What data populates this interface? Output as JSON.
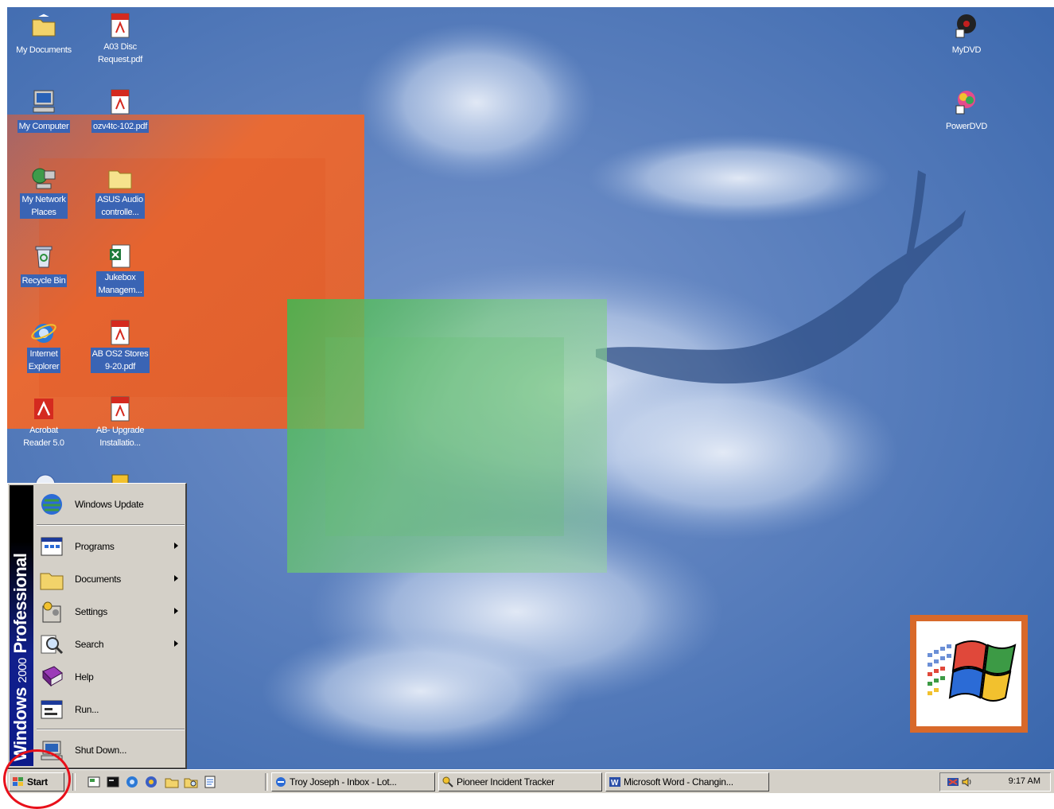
{
  "desktop": {
    "icons_left": [
      {
        "label": "My Documents",
        "icon": "folder-documents-icon",
        "selected": false
      },
      {
        "label": "A03 Disc\nRequest.pdf",
        "icon": "pdf-file-icon",
        "selected": false
      },
      {
        "label": "My Computer",
        "icon": "computer-icon",
        "selected": true
      },
      {
        "label": "ozv4tc-102.pdf",
        "icon": "pdf-file-icon",
        "selected": true
      },
      {
        "label": "My Network\nPlaces",
        "icon": "network-places-icon",
        "selected": true
      },
      {
        "label": "ASUS Audio\ncontrolle...",
        "icon": "folder-icon",
        "selected": true
      },
      {
        "label": "Recycle Bin",
        "icon": "recycle-bin-icon",
        "selected": true
      },
      {
        "label": "Jukebox\nManagem...",
        "icon": "excel-file-icon",
        "selected": true
      },
      {
        "label": "Internet\nExplorer",
        "icon": "internet-explorer-icon",
        "selected": true
      },
      {
        "label": "AB OS2 Stores\n9-20.pdf",
        "icon": "pdf-file-icon",
        "selected": true
      },
      {
        "label": "Acrobat\nReader 5.0",
        "icon": "acrobat-reader-icon",
        "selected": false
      },
      {
        "label": "AB- Upgrade\nInstallatio...",
        "icon": "pdf-file-icon",
        "selected": false
      }
    ],
    "icons_right": [
      {
        "label": "MyDVD",
        "icon": "mydvd-icon"
      },
      {
        "label": "PowerDVD",
        "icon": "powerdvd-icon"
      }
    ]
  },
  "start_menu": {
    "banner_bold": "Windows",
    "banner_light": "2000",
    "banner_edition": "Professional",
    "items": [
      {
        "label": "Windows Update",
        "icon": "windows-update-icon",
        "submenu": false
      },
      {
        "label": "Programs",
        "icon": "programs-icon",
        "submenu": true
      },
      {
        "label": "Documents",
        "icon": "documents-folder-icon",
        "submenu": true
      },
      {
        "label": "Settings",
        "icon": "settings-icon",
        "submenu": true
      },
      {
        "label": "Search",
        "icon": "search-icon",
        "submenu": true
      },
      {
        "label": "Help",
        "icon": "help-book-icon",
        "submenu": false
      },
      {
        "label": "Run...",
        "icon": "run-icon",
        "submenu": false
      },
      {
        "label": "Shut Down...",
        "icon": "shutdown-icon",
        "submenu": false
      }
    ]
  },
  "taskbar": {
    "start_label": "Start",
    "quick_launch": [
      "show-desktop-icon",
      "console-icon",
      "internet-explorer-icon",
      "outlook-icon",
      "folder-icon",
      "explorer-icon",
      "document-icon"
    ],
    "tasks": [
      {
        "label": "Troy Joseph - Inbox - Lot...",
        "icon": "mail-app-icon"
      },
      {
        "label": "Pioneer Incident Tracker",
        "icon": "tracker-app-icon"
      },
      {
        "label": "Microsoft Word - Changin...",
        "icon": "word-app-icon"
      }
    ],
    "clock": "9:17 AM"
  },
  "colors": {
    "desktop_blue": "#3f6fae",
    "taskbar_gray": "#d4d0c8",
    "selection_blue": "#3a64b4",
    "highlight_ring": "#e8101a"
  }
}
